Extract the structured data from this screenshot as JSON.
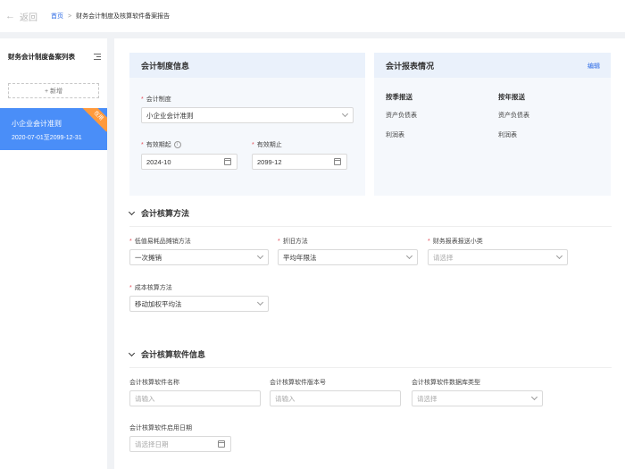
{
  "topbar": {
    "back_label": "返回",
    "breadcrumb": {
      "home": "首页",
      "separator": ">",
      "current": "财务会计制度及核算软件备案报告"
    }
  },
  "sidebar": {
    "title": "财务会计制度备案列表",
    "add_label": "+ 新增",
    "policies": [
      {
        "name": "小企业会计准则",
        "range": "2020-07-01至2099-12-31",
        "badge": "在用"
      }
    ]
  },
  "policy_info": {
    "title": "会计制度信息",
    "system": {
      "label": "会计制度",
      "value": "小企业会计准则"
    },
    "start": {
      "label": "有效期起",
      "value": "2024-10"
    },
    "end": {
      "label": "有效期止",
      "value": "2099-12"
    }
  },
  "report_info": {
    "title": "会计报表情况",
    "edit_label": "编辑",
    "quarterly": {
      "title": "按季报送",
      "items": [
        "资产负债表",
        "利润表"
      ]
    },
    "annual": {
      "title": "按年报送",
      "items": [
        "资产负债表",
        "利润表"
      ]
    }
  },
  "accounting_method": {
    "title": "会计核算方法",
    "fields": [
      {
        "label": "低值易耗品摊销方法",
        "value": "一次摊销",
        "placeholder": ""
      },
      {
        "label": "折旧方法",
        "value": "平均年限法",
        "placeholder": ""
      },
      {
        "label": "财务报表报送小类",
        "value": "",
        "placeholder": "请选择"
      },
      {
        "label": "成本核算方法",
        "value": "移动加权平均法",
        "placeholder": ""
      }
    ]
  },
  "software_info": {
    "title": "会计核算软件信息",
    "name": {
      "label": "会计核算软件名称",
      "placeholder": "请输入"
    },
    "version": {
      "label": "会计核算软件版本号",
      "placeholder": "请输入"
    },
    "db_type": {
      "label": "会计核算软件数据库类型",
      "placeholder": "请选择"
    },
    "start_date": {
      "label": "会计核算软件启用日期",
      "placeholder": "请选择日期"
    }
  },
  "colors": {
    "accent": "#4a8ef8",
    "link": "#2d6be6",
    "badge": "#ff9a3c",
    "required": "#e34d59",
    "panel_header": "#eaf1fb"
  }
}
